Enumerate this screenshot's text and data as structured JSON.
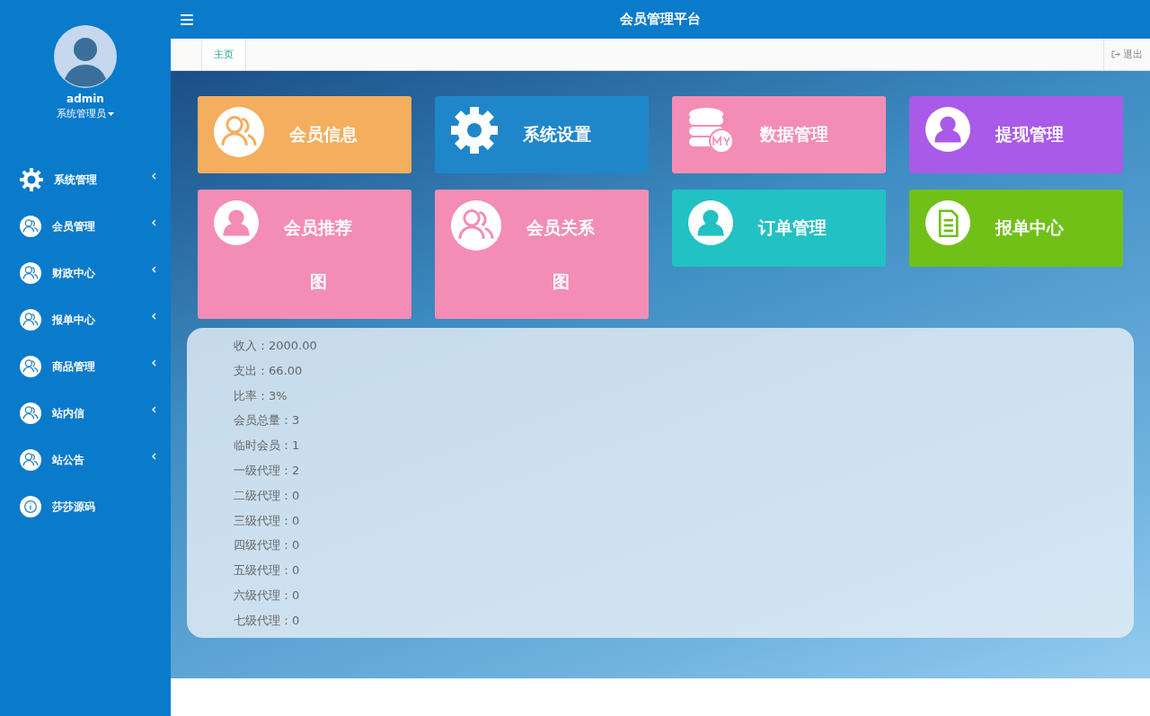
{
  "header": {
    "title": "会员管理平台"
  },
  "user": {
    "name": "admin",
    "role": "系统管理员"
  },
  "sidebar": {
    "items": [
      {
        "label": "系统管理",
        "kind": "settings",
        "expandable": true
      },
      {
        "label": "会员管理",
        "kind": "group",
        "expandable": true
      },
      {
        "label": "财政中心",
        "kind": "group",
        "expandable": true
      },
      {
        "label": "报单中心",
        "kind": "group",
        "expandable": true
      },
      {
        "label": "商品管理",
        "kind": "group",
        "expandable": true
      },
      {
        "label": "站内信",
        "kind": "group",
        "expandable": true
      },
      {
        "label": "站公告",
        "kind": "group",
        "expandable": true
      },
      {
        "label": "莎莎源码",
        "kind": "info",
        "expandable": false
      }
    ]
  },
  "tabs": [
    {
      "label": "主页",
      "selected": true
    }
  ],
  "logout": "退出",
  "tiles": [
    {
      "label": "会员信息",
      "kind": "group",
      "color": "#f5ad5e"
    },
    {
      "label": "系统设置",
      "kind": "gear",
      "color": "#1f86c9"
    },
    {
      "label": "数据管理",
      "kind": "database",
      "color": "#f38db5"
    },
    {
      "label": "提现管理",
      "kind": "person",
      "color": "#a95ae8"
    },
    {
      "label": "会员推荐图",
      "kind": "person",
      "color": "#f38db5"
    },
    {
      "label": "会员关系图",
      "kind": "group",
      "color": "#f38db5"
    },
    {
      "label": "订单管理",
      "kind": "person",
      "color": "#22c1c3"
    },
    {
      "label": "报单中心",
      "kind": "document",
      "color": "#70c018"
    }
  ],
  "stats": [
    "收入：2000.00",
    "支出：66.00",
    "比率：3%",
    "会员总量：3",
    "临时会员：1",
    "一级代理：2",
    "二级代理：0",
    "三级代理：0",
    "四级代理：0",
    "五级代理：0",
    "六级代理：0",
    "七级代理：0"
  ]
}
